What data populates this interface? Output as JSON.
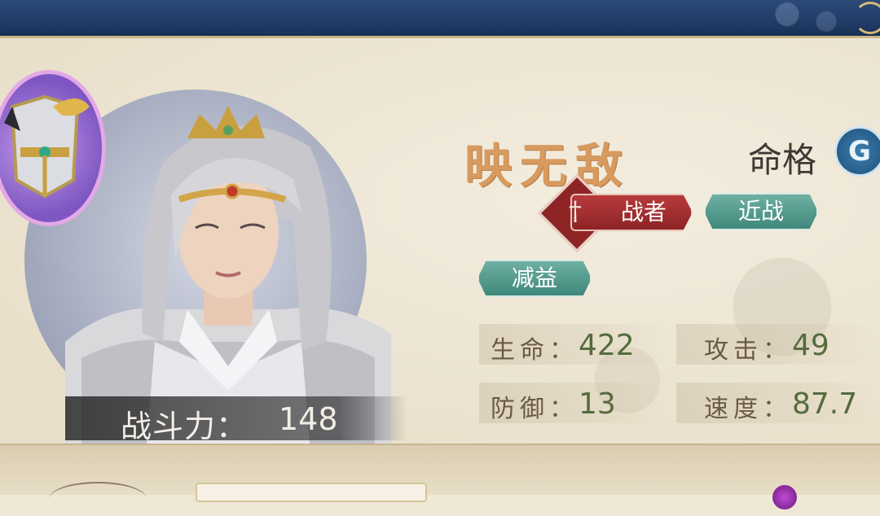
{
  "hero": {
    "name": "映无敌",
    "destiny_label": "命格",
    "destiny_icon": "swirl-icon",
    "combat_power_label": "战斗力：",
    "combat_power_value": "148"
  },
  "tags": {
    "role": "战者",
    "range": "近战",
    "effect": "减益"
  },
  "stats": [
    {
      "label": "生命：",
      "value": "422"
    },
    {
      "label": "攻击：",
      "value": "49"
    },
    {
      "label": "防御：",
      "value": "13"
    },
    {
      "label": "速度：",
      "value": "87.7"
    }
  ],
  "colors": {
    "name": "#d79a5f",
    "role_tag": "#a8302f",
    "green_tag": "#4f9a8c",
    "stat_value": "#556b3e",
    "stat_label": "#6b5a43",
    "top_bar": "#1f3a64"
  }
}
